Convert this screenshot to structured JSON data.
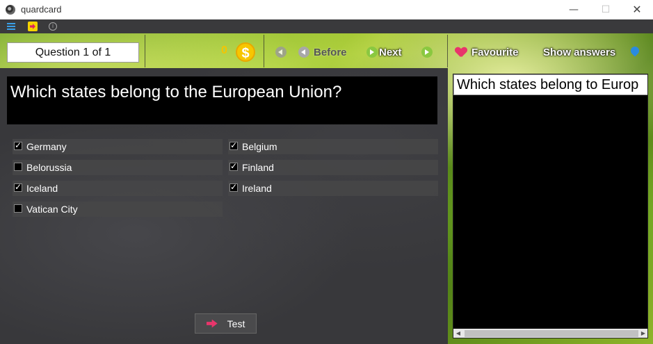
{
  "window": {
    "title": "quardcard",
    "minimize_glyph": "—",
    "maximize_glyph": "☐",
    "close_glyph": "✕"
  },
  "toolbar": {
    "icons": [
      "menu-icon",
      "exit-icon",
      "info-icon"
    ],
    "info_glyph": "i"
  },
  "nav": {
    "question_counter": "Question 1 of 1",
    "coins": "0",
    "coin_symbol": "$",
    "before_label": "Before",
    "next_label": "Next",
    "favourite_label": "Favourite",
    "show_answers_label": "Show answers"
  },
  "question": {
    "text": "Which states belong to the European Union?"
  },
  "answers": [
    {
      "label": "Germany",
      "checked": true
    },
    {
      "label": "Belgium",
      "checked": true
    },
    {
      "label": "Belorussia",
      "checked": false
    },
    {
      "label": "Finland",
      "checked": true
    },
    {
      "label": "Iceland",
      "checked": true
    },
    {
      "label": "Ireland",
      "checked": true
    },
    {
      "label": "Vatican City",
      "checked": false
    }
  ],
  "actions": {
    "test_label": "Test"
  },
  "preview": {
    "text": "Which states belong to Europ",
    "scroll_left": "◀",
    "scroll_right": "▶"
  },
  "colors": {
    "accent_pink": "#e8356b",
    "coin_yellow": "#f7c600",
    "board": "#38383b"
  }
}
